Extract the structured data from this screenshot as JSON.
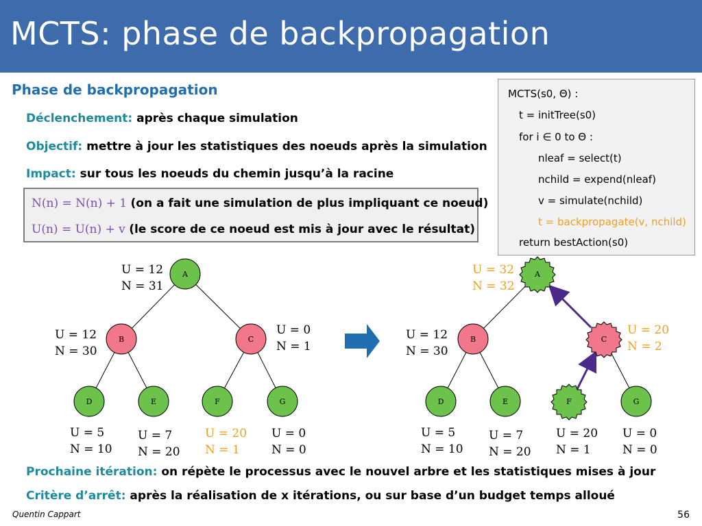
{
  "slide": {
    "title": "MCTS: phase de backpropagation",
    "section_title": "Phase de backpropagation",
    "author": "Quentin Cappart",
    "page_number": "56"
  },
  "bullets": [
    {
      "label": "Déclenchement:",
      "text": "après chaque simulation"
    },
    {
      "label": "Objectif:",
      "text": "mettre à jour les statistiques des noeuds après la simulation"
    },
    {
      "label": "Impact:",
      "text": "sur tous les noeuds du chemin jusqu’à la racine"
    }
  ],
  "formulas": [
    {
      "math": "N(n) = N(n) + 1",
      "desc": "(on a fait une simulation de plus impliquant ce noeud)"
    },
    {
      "math": "U(n) = U(n) + v",
      "desc": "(le score de ce noeud est mis à jour avec le résultat)"
    }
  ],
  "algorithm": {
    "lines": [
      "MCTS(s0, Θ) :",
      "t = initTree(s0)",
      "for i ∈ 0 to Θ :",
      "nleaf = select(t)",
      "nchild = expend(nleaf)",
      "v = simulate(nchild)",
      "t = backpropagate(v, nchild)",
      "return bestAction(s0)"
    ]
  },
  "tree_before": {
    "nodes": {
      "A": "A",
      "B": "B",
      "C": "C",
      "D": "D",
      "E": "E",
      "F": "F",
      "G": "G"
    },
    "stats": {
      "A": {
        "U": "U = 12",
        "N": "N = 31"
      },
      "B": {
        "U": "U = 12",
        "N": "N = 30"
      },
      "C": {
        "U": "U = 0",
        "N": "N = 1"
      },
      "D": {
        "U": "U = 5",
        "N": "N = 10"
      },
      "E": {
        "U": "U = 7",
        "N": "N = 20"
      },
      "F": {
        "U": "U = 20",
        "N": "N = 1"
      },
      "G": {
        "U": "U = 0",
        "N": "N = 0"
      }
    }
  },
  "tree_after": {
    "nodes": {
      "A": "A",
      "B": "B",
      "C": "C",
      "D": "D",
      "E": "E",
      "F": "F",
      "G": "G"
    },
    "stats": {
      "A": {
        "U": "U = 32",
        "N": "N = 32"
      },
      "B": {
        "U": "U = 12",
        "N": "N = 30"
      },
      "C": {
        "U": "U = 20",
        "N": "N = 2"
      },
      "D": {
        "U": "U = 5",
        "N": "N = 10"
      },
      "E": {
        "U": "U = 7",
        "N": "N = 20"
      },
      "F": {
        "U": "U = 20",
        "N": "N = 1"
      },
      "G": {
        "U": "U = 0",
        "N": "N = 0"
      }
    }
  },
  "bottom_bullets": [
    {
      "label": "Prochaine itération:",
      "text": "on répète le processus avec le nouvel arbre et les statistiques mises à jour"
    },
    {
      "label": "Critère d’arrêt:",
      "text": "après la réalisation de x itérations, ou sur base d’un budget temps alloué"
    }
  ],
  "colors": {
    "title_bar": "#3d6bab",
    "label": "#1f8a9a",
    "green_node": "#6cc24a",
    "red_node": "#f0788a",
    "highlight": "#f0a020",
    "path_arrow": "#4b2a8a",
    "arrow": "#1f6fb0"
  }
}
